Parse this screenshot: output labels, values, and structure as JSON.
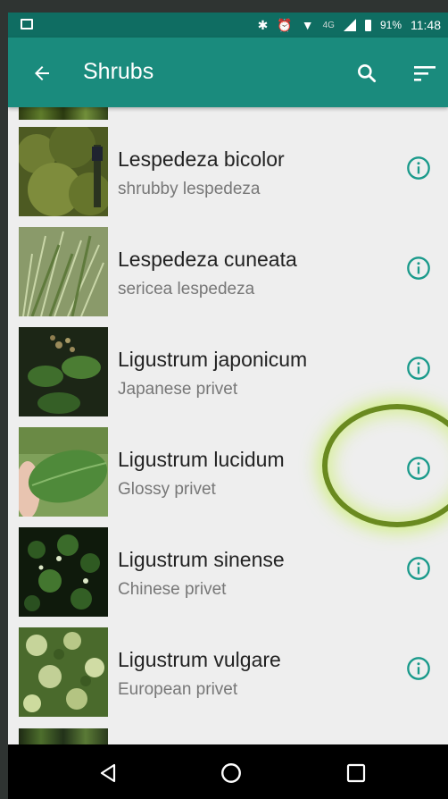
{
  "status_bar": {
    "network": "4G",
    "battery": "91%",
    "time": "11:48"
  },
  "app_bar": {
    "title": "Shrubs",
    "back_icon": "arrow-left-icon",
    "search_icon": "search-icon",
    "sort_icon": "sort-icon"
  },
  "plants": [
    {
      "scientific": "Lespedeza bicolor",
      "common": "shrubby lespedeza",
      "info_icon": "info-icon"
    },
    {
      "scientific": "Lespedeza cuneata",
      "common": "sericea lespedeza",
      "info_icon": "info-icon"
    },
    {
      "scientific": "Ligustrum japonicum",
      "common": "Japanese privet",
      "info_icon": "info-icon"
    },
    {
      "scientific": "Ligustrum lucidum",
      "common": "Glossy privet",
      "info_icon": "info-icon"
    },
    {
      "scientific": "Ligustrum sinense",
      "common": "Chinese privet",
      "info_icon": "info-icon"
    },
    {
      "scientific": "Ligustrum vulgare",
      "common": "European privet",
      "info_icon": "info-icon"
    }
  ],
  "colors": {
    "status_bar": "#0f6d62",
    "app_bar": "#1a8b7d",
    "accent": "#1a9a8b",
    "highlight": "#6a8a1f"
  }
}
